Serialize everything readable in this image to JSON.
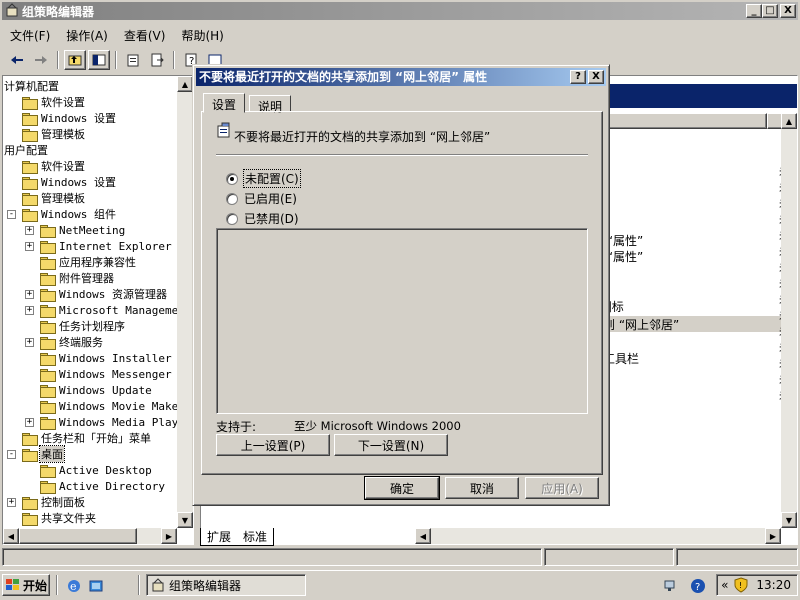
{
  "window": {
    "title": "组策略编辑器",
    "buttons": {
      "minimize": "_",
      "maximize": "□",
      "close": "X"
    }
  },
  "menu": [
    "文件(F)",
    "操作(A)",
    "查看(V)",
    "帮助(H)"
  ],
  "tree": [
    {
      "label": "计算机配置",
      "indent": 0,
      "exp": ""
    },
    {
      "label": "软件设置",
      "indent": 1,
      "exp": ""
    },
    {
      "label": "Windows 设置",
      "indent": 1,
      "exp": ""
    },
    {
      "label": "管理模板",
      "indent": 1,
      "exp": ""
    },
    {
      "label": "用户配置",
      "indent": 0,
      "exp": ""
    },
    {
      "label": "软件设置",
      "indent": 1,
      "exp": ""
    },
    {
      "label": "Windows 设置",
      "indent": 1,
      "exp": ""
    },
    {
      "label": "管理模板",
      "indent": 1,
      "exp": ""
    },
    {
      "label": "Windows 组件",
      "indent": 1,
      "exp": "-"
    },
    {
      "label": "NetMeeting",
      "indent": 2,
      "exp": "+"
    },
    {
      "label": "Internet Explorer",
      "indent": 2,
      "exp": "+"
    },
    {
      "label": "应用程序兼容性",
      "indent": 2,
      "exp": ""
    },
    {
      "label": "附件管理器",
      "indent": 2,
      "exp": ""
    },
    {
      "label": "Windows 资源管理器",
      "indent": 2,
      "exp": "+"
    },
    {
      "label": "Microsoft Management",
      "indent": 2,
      "exp": "+"
    },
    {
      "label": "任务计划程序",
      "indent": 2,
      "exp": ""
    },
    {
      "label": "终端服务",
      "indent": 2,
      "exp": "+"
    },
    {
      "label": "Windows Installer",
      "indent": 2,
      "exp": ""
    },
    {
      "label": "Windows Messenger",
      "indent": 2,
      "exp": ""
    },
    {
      "label": "Windows Update",
      "indent": 2,
      "exp": ""
    },
    {
      "label": "Windows Movie Maker",
      "indent": 2,
      "exp": ""
    },
    {
      "label": "Windows Media Player",
      "indent": 2,
      "exp": "+"
    },
    {
      "label": "任务栏和「开始」菜单",
      "indent": 1,
      "exp": ""
    },
    {
      "label": "桌面",
      "indent": 1,
      "exp": "-",
      "selected": true
    },
    {
      "label": "Active Desktop",
      "indent": 2,
      "exp": ""
    },
    {
      "label": "Active Directory",
      "indent": 2,
      "exp": ""
    },
    {
      "label": "控制面板",
      "indent": 1,
      "exp": "+"
    },
    {
      "label": "共享文件夹",
      "indent": 1,
      "exp": ""
    }
  ],
  "right_items": [
    {
      "text": "除 “属性”",
      "hl": false
    },
    {
      "text": "除 “属性”",
      "hl": false
    },
    {
      "text": "性",
      "hl": false
    },
    {
      "text": "r 图标",
      "hl": false
    },
    {
      "text": "加到 “网上邻居”",
      "hl": true
    },
    {
      "text": "的工具栏",
      "hl": false
    }
  ],
  "bottom_tabs": [
    "扩展",
    "标准"
  ],
  "dialog": {
    "title": "不要将最近打开的文档的共享添加到 “网上邻居” 属性",
    "help_btn": "?",
    "close_btn": "X",
    "tabs": [
      "设置",
      "说明"
    ],
    "policy_name": "不要将最近打开的文档的共享添加到 “网上邻居”",
    "options": [
      {
        "label": "未配置(C)",
        "checked": true
      },
      {
        "label": "已启用(E)",
        "checked": false
      },
      {
        "label": "已禁用(D)",
        "checked": false
      }
    ],
    "supported_label": "支持于:",
    "supported_value": "至少 Microsoft Windows 2000",
    "prev_btn": "上一设置(P)",
    "next_btn": "下一设置(N)",
    "ok_btn": "确定",
    "cancel_btn": "取消",
    "apply_btn": "应用(A)"
  },
  "taskbar": {
    "start": "开始",
    "task": "组策略编辑器",
    "clock": "13:20",
    "chevron": "«"
  }
}
